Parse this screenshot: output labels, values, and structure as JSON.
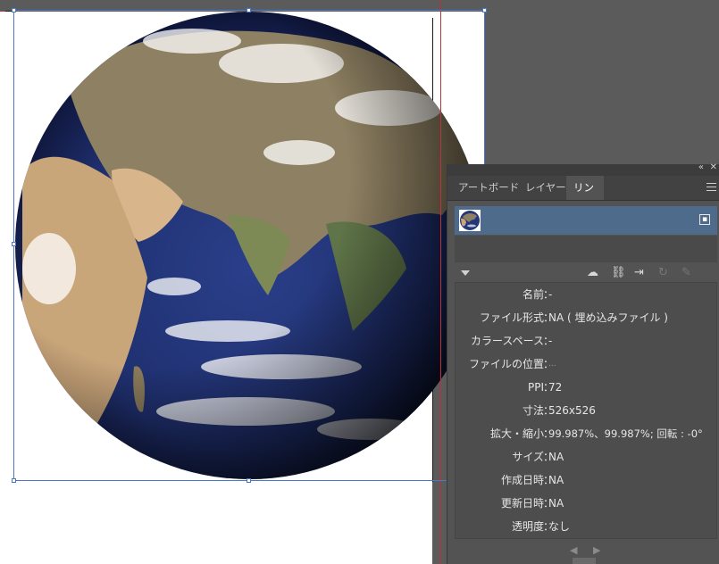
{
  "panel": {
    "title_icons": {
      "collapse": "«",
      "close": "✕"
    },
    "tabs": [
      {
        "label": "アートボード",
        "active": false
      },
      {
        "label": "レイヤー",
        "active": false
      },
      {
        "label": "リンク",
        "active": true
      }
    ],
    "menu_icon": "panel-menu-icon",
    "selected_link": {
      "thumbnail": "earth-thumbnail",
      "status_icon": "embed-icon"
    },
    "toolbar_icons": [
      "cloud-link-icon",
      "relink-icon",
      "go-to-link-icon",
      "update-link-icon",
      "edit-original-icon"
    ],
    "info": [
      {
        "label": "名前",
        "value": "-"
      },
      {
        "label": "ファイル形式",
        "value": "NA ( 埋め込みファイル )"
      },
      {
        "label": "カラースペース",
        "value": "-"
      },
      {
        "label": "ファイルの位置",
        "value": "..."
      },
      {
        "label": "PPI",
        "value": "72"
      },
      {
        "label": "寸法",
        "value": "526x526"
      },
      {
        "label": "拡大・縮小",
        "value": "99.987%、99.987%; 回転 : -0°"
      },
      {
        "label": "サイズ",
        "value": "NA"
      },
      {
        "label": "作成日時",
        "value": "NA"
      },
      {
        "label": "更新日時",
        "value": "NA"
      },
      {
        "label": "透明度",
        "value": "なし"
      }
    ],
    "separator": "：",
    "nav": {
      "prev": "◀",
      "next": "▶"
    }
  },
  "colors": {
    "canvas": "#5b5b5b",
    "panel": "#535353",
    "selection": "#4e6b8c",
    "bounding_box": "#4a78c8",
    "guide": "#c0303a"
  }
}
